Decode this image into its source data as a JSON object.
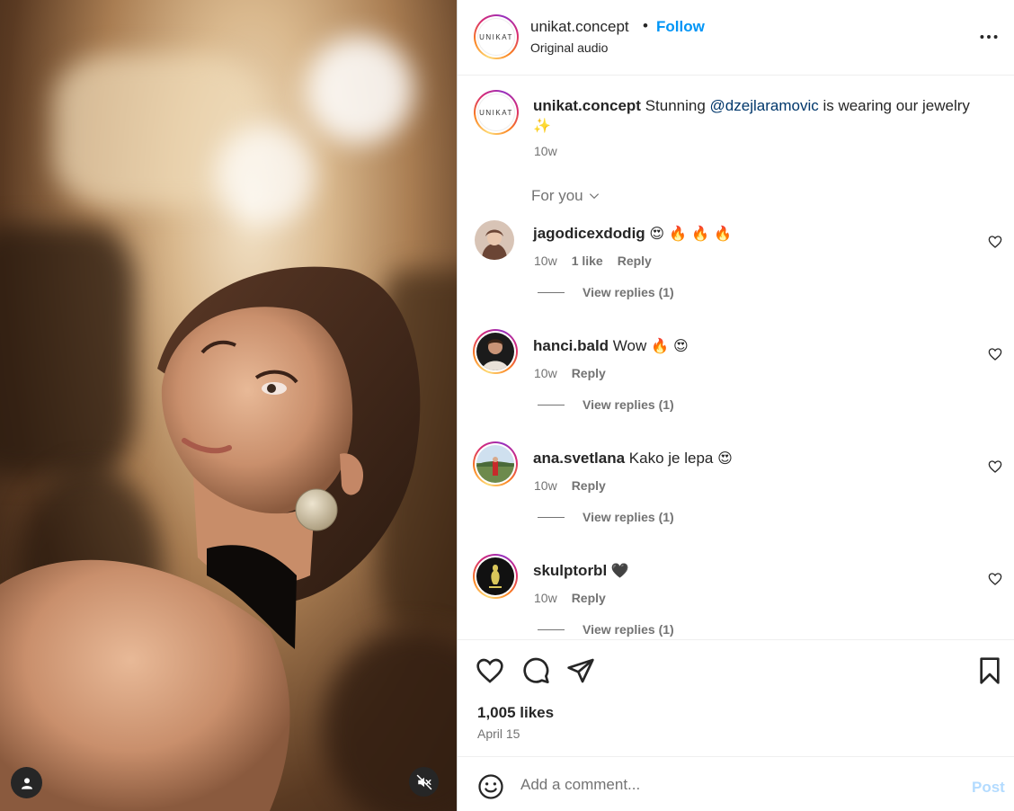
{
  "post": {
    "username": "unikat.concept",
    "separator": "•",
    "follow_label": "Follow",
    "audio": "Original audio",
    "logo_text": "UNIKAT",
    "more_icon": "more-horizontal-icon"
  },
  "caption": {
    "username": "unikat.concept",
    "text_before": " Stunning ",
    "mention": "@dzejlaramovic",
    "text_after": " is wearing our jewelry ",
    "emoji": "✨",
    "time": "10w"
  },
  "filter": {
    "label": "For you",
    "icon": "chevron-down-icon"
  },
  "comments": [
    {
      "username": "jagodicexdodig",
      "text": "",
      "emoji": "😍 🔥 🔥 🔥",
      "time": "10w",
      "likes": "1 like",
      "reply": "Reply",
      "view_replies": "View replies (1)"
    },
    {
      "username": "hanci.bald",
      "text": " Wow ",
      "emoji": "🔥 😍",
      "time": "10w",
      "likes": "",
      "reply": "Reply",
      "view_replies": "View replies (1)"
    },
    {
      "username": "ana.svetlana",
      "text": " Kako je lepa ",
      "emoji": "😍",
      "time": "10w",
      "likes": "",
      "reply": "Reply",
      "view_replies": "View replies (1)"
    },
    {
      "username": "skulptorbl",
      "text": " ",
      "emoji": "🖤",
      "time": "10w",
      "likes": "",
      "reply": "Reply",
      "view_replies": "View replies (1)"
    }
  ],
  "footer": {
    "likes": "1,005 likes",
    "date": "April 15",
    "comment_placeholder": "Add a comment...",
    "post_label": "Post"
  },
  "colors": {
    "accent": "#0095f6",
    "mention": "#00376b",
    "muted": "#737373",
    "post_disabled": "#b3dbff"
  }
}
